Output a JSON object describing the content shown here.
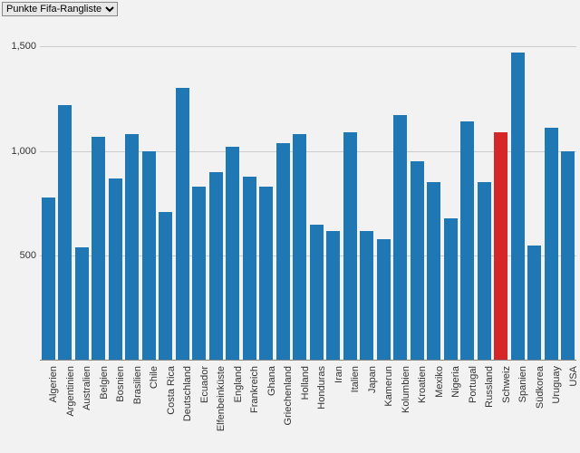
{
  "controls": {
    "selector": {
      "selected": "Punkte Fifa-Rangliste",
      "options": [
        "Punkte Fifa-Rangliste"
      ]
    }
  },
  "chart_data": {
    "type": "bar",
    "title": "",
    "xlabel": "",
    "ylabel": "",
    "ylim": [
      0,
      1600
    ],
    "y_ticks": [
      500,
      1000,
      1500
    ],
    "y_tick_labels": [
      "500",
      "1,000",
      "1,500"
    ],
    "highlight_category": "Schweiz",
    "colors": {
      "default": "#1f77b4",
      "highlight": "#d62728"
    },
    "categories": [
      "Algerien",
      "Argentinien",
      "Australien",
      "Belgien",
      "Bosnien",
      "Brasilien",
      "Chile",
      "Costa Rica",
      "Deutschland",
      "Ecuador",
      "Elfenbeinküste",
      "England",
      "Frankreich",
      "Ghana",
      "Griechenland",
      "Holland",
      "Honduras",
      "Iran",
      "Italien",
      "Japan",
      "Kamerun",
      "Kolumbien",
      "Kroatien",
      "Mexiko",
      "Nigeria",
      "Portugal",
      "Russland",
      "Schweiz",
      "Spanien",
      "Südkorea",
      "Uruguay",
      "USA"
    ],
    "values": [
      780,
      1220,
      540,
      1070,
      870,
      1080,
      1000,
      710,
      1300,
      830,
      900,
      1020,
      880,
      830,
      1040,
      1080,
      650,
      620,
      1090,
      620,
      580,
      1170,
      950,
      850,
      680,
      1140,
      850,
      1090,
      1470,
      550,
      1110,
      1000
    ]
  }
}
